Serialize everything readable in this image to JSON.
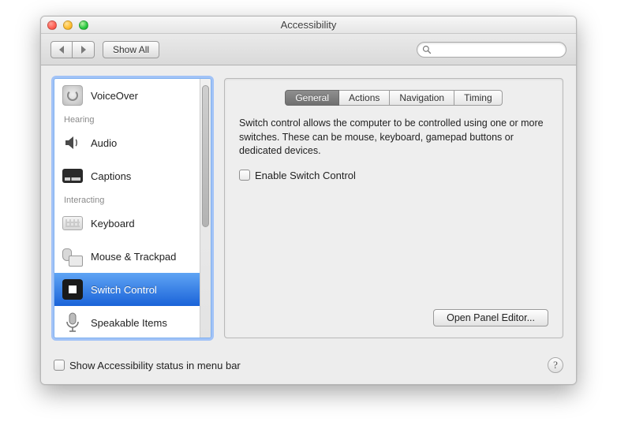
{
  "window": {
    "title": "Accessibility"
  },
  "toolbar": {
    "showall_label": "Show All",
    "search_placeholder": ""
  },
  "sidebar": {
    "sections": [
      {
        "label": "",
        "items": [
          {
            "id": "voiceover",
            "label": "VoiceOver"
          }
        ]
      },
      {
        "label": "Hearing",
        "items": [
          {
            "id": "audio",
            "label": "Audio"
          },
          {
            "id": "captions",
            "label": "Captions"
          }
        ]
      },
      {
        "label": "Interacting",
        "items": [
          {
            "id": "keyboard",
            "label": "Keyboard"
          },
          {
            "id": "mouse-trackpad",
            "label": "Mouse & Trackpad"
          },
          {
            "id": "switch-control",
            "label": "Switch Control",
            "selected": true
          },
          {
            "id": "speakable-items",
            "label": "Speakable Items"
          }
        ]
      }
    ]
  },
  "tabs": [
    {
      "id": "general",
      "label": "General",
      "selected": true
    },
    {
      "id": "actions",
      "label": "Actions"
    },
    {
      "id": "navigation",
      "label": "Navigation"
    },
    {
      "id": "timing",
      "label": "Timing"
    }
  ],
  "panel": {
    "description": "Switch control allows the computer to be controlled using one or more switches. These can be mouse, keyboard, gamepad buttons or dedicated devices.",
    "enable_label": "Enable Switch Control",
    "enable_checked": false,
    "open_panel_label": "Open Panel Editor..."
  },
  "footer": {
    "status_label": "Show Accessibility status in menu bar",
    "status_checked": false
  },
  "search_glyph": "Q"
}
